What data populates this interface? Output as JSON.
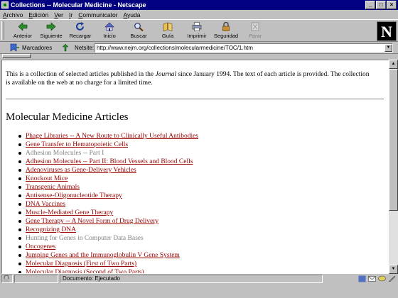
{
  "window": {
    "title": "Collections -- Molecular Medicine - Netscape",
    "controls": [
      "_",
      "□",
      "×"
    ]
  },
  "menu": [
    "Archivo",
    "Edición",
    "Ver",
    "Ir",
    "Communicator",
    "Ayuda"
  ],
  "toolbar": {
    "buttons": [
      {
        "label": "Anterior",
        "icon": "back-arrow-icon"
      },
      {
        "label": "Siguiente",
        "icon": "forward-arrow-icon"
      },
      {
        "label": "Recargar",
        "icon": "reload-icon"
      },
      {
        "label": "Inicio",
        "icon": "home-icon"
      },
      {
        "label": "Buscar",
        "icon": "search-icon"
      },
      {
        "label": "Guía",
        "icon": "guide-icon"
      },
      {
        "label": "Imprimir",
        "icon": "print-icon"
      },
      {
        "label": "Seguridad",
        "icon": "security-lock-icon"
      },
      {
        "label": "Parar",
        "icon": "stop-icon",
        "disabled": true
      }
    ],
    "logo": "N"
  },
  "location": {
    "bookmarks_label": "Marcadores",
    "label": "Netsite:",
    "url": "http://www.nejm.org/collections/molecularmedicine/TOC/1.htm"
  },
  "page": {
    "intro_before": "This is a collection of selected articles published in the ",
    "intro_journal": "Journal",
    "intro_after": " since January 1994. The text of each article is provided. The collection is available on the web at no charge for a limited time.",
    "heading": "Molecular Medicine Articles",
    "articles": [
      {
        "title": "Phage Libraries -- A New Route to Clinically Useful Antibodies",
        "visited": false
      },
      {
        "title": "Gene Transfer to Hematopoietic Cells",
        "visited": false
      },
      {
        "title": "Adhesion Molecules -- Part I",
        "visited": true
      },
      {
        "title": "Adhesion Molecules -- Part II: Blood Vessels and Blood Cells",
        "visited": false
      },
      {
        "title": "Adenoviruses as Gene-Delivery Vehicles",
        "visited": false
      },
      {
        "title": "Knockout Mice",
        "visited": false
      },
      {
        "title": "Transgenic Animals",
        "visited": false
      },
      {
        "title": "Antisense-Oligonucleotide Therapy",
        "visited": false
      },
      {
        "title": "DNA Vaccines",
        "visited": false
      },
      {
        "title": "Muscle-Mediated Gene Therapy",
        "visited": false
      },
      {
        "title": "Gene Therapy -- A Novel Form of Drug Delivery",
        "visited": false
      },
      {
        "title": "Recognizing DNA",
        "visited": false
      },
      {
        "title": "Hunting for Genes in Computer Data Bases",
        "visited": true
      },
      {
        "title": "Oncogenes",
        "visited": false
      },
      {
        "title": "Jumping Genes and the Immunoglobulin V Gene System",
        "visited": false
      },
      {
        "title": "Molecular Diagnosis (First of Two Parts)",
        "visited": false
      },
      {
        "title": "Molecular Diagnosis (Second of Two Parts)",
        "visited": false
      }
    ]
  },
  "status": {
    "text": "Documento: Ejecutado"
  },
  "colors": {
    "titlebar": "#000080",
    "link": "#990000",
    "visited_link": "#808080",
    "chrome": "#c0c0c0"
  }
}
